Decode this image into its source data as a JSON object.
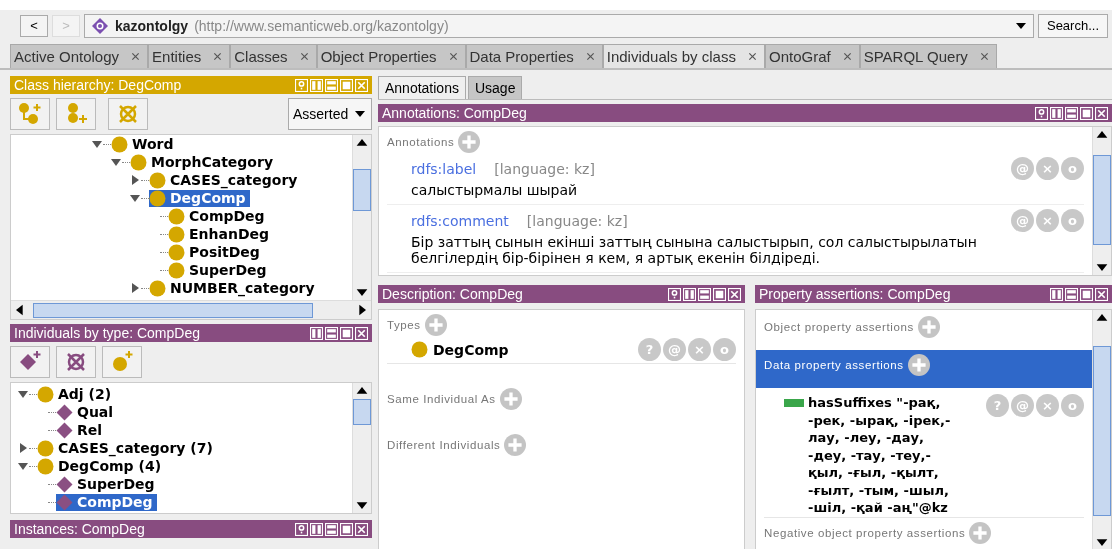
{
  "nav": [
    {
      "label": "<",
      "disabled": false
    },
    {
      "label": ">",
      "disabled": true
    }
  ],
  "address": {
    "name": "kazontolgy",
    "iri": "(http://www.semanticweb.org/kazontolgy)"
  },
  "search_button": "Search...",
  "tabs": [
    {
      "label": "Active Ontology",
      "selected": false
    },
    {
      "label": "Entities",
      "selected": false
    },
    {
      "label": "Classes",
      "selected": false
    },
    {
      "label": "Object Properties",
      "selected": false
    },
    {
      "label": "Data Properties",
      "selected": false
    },
    {
      "label": "Individuals by class",
      "selected": true
    },
    {
      "label": "OntoGraf",
      "selected": false
    },
    {
      "label": "SPARQL Query",
      "selected": false
    }
  ],
  "class_hierarchy": {
    "title": "Class hierarchy: DegComp",
    "help_button": true,
    "mode": "Asserted",
    "tree": [
      {
        "label": "Word",
        "kind": "class",
        "expanded": true,
        "selected": false,
        "children": [
          {
            "label": "MorphCategory",
            "kind": "class",
            "expanded": true,
            "selected": false,
            "children": [
              {
                "label": "CASES_category",
                "kind": "class",
                "expanded": false,
                "selected": false
              },
              {
                "label": "DegComp",
                "kind": "class",
                "expanded": true,
                "selected": true,
                "children": [
                  {
                    "label": "CompDeg",
                    "kind": "class",
                    "selected": false
                  },
                  {
                    "label": "EnhanDeg",
                    "kind": "class",
                    "selected": false
                  },
                  {
                    "label": "PositDeg",
                    "kind": "class",
                    "selected": false
                  },
                  {
                    "label": "SuperDeg",
                    "kind": "class",
                    "selected": false
                  }
                ]
              },
              {
                "label": "NUMBER_category",
                "kind": "class",
                "expanded": false,
                "selected": false
              }
            ]
          }
        ]
      }
    ]
  },
  "individuals_by_type": {
    "title": "Individuals by type: CompDeg",
    "help_button": false,
    "tree": [
      {
        "label": "Adj (2)",
        "kind": "class",
        "expanded": true,
        "selected": false,
        "children": [
          {
            "label": "Qual",
            "kind": "individual",
            "selected": false
          },
          {
            "label": "Rel",
            "kind": "individual",
            "selected": false
          }
        ]
      },
      {
        "label": "CASES_category (7)",
        "kind": "class",
        "expanded": false,
        "selected": false
      },
      {
        "label": "DegComp (4)",
        "kind": "class",
        "expanded": true,
        "selected": false,
        "children": [
          {
            "label": "SuperDeg",
            "kind": "individual",
            "selected": false
          },
          {
            "label": "CompDeg",
            "kind": "individual",
            "selected": true
          }
        ]
      }
    ]
  },
  "instances": {
    "title": "Instances: CompDeg",
    "help_button": true
  },
  "editor_tabs": [
    {
      "label": "Annotations",
      "selected": true
    },
    {
      "label": "Usage",
      "selected": false
    }
  ],
  "annotations": {
    "title": "Annotations: CompDeg",
    "help_button": true,
    "section": "Annotations",
    "items": [
      {
        "property": "rdfs:label",
        "language": "[language: kz]",
        "value": "салыстырмалы шырай",
        "actions": [
          "@",
          "×",
          "o"
        ]
      },
      {
        "property": "rdfs:comment",
        "language": "[language: kz]",
        "value": "Бір заттың сынын екінші заттың сынына салыстырып, сол салыстырылатын белгілердің бір-бірінен я кем, я артық екенін білдіреді.",
        "actions": [
          "@",
          "×",
          "o"
        ]
      }
    ]
  },
  "description": {
    "title": "Description: CompDeg",
    "help_button": true,
    "sections": [
      {
        "label": "Types",
        "items": [
          {
            "label": "DegComp",
            "actions": [
              "?",
              "@",
              "×",
              "o"
            ]
          }
        ]
      },
      {
        "label": "Same Individual As"
      },
      {
        "label": "Different Individuals"
      }
    ]
  },
  "property_assertions": {
    "title": "Property assertions: CompDeg",
    "help_button": false,
    "sections": [
      {
        "label": "Object property assertions",
        "selected": false
      },
      {
        "label": "Data property assertions",
        "selected": true,
        "items": [
          {
            "property": "hasSuffixes",
            "value": "\"-рақ, -рек, -ырақ, -ірек,-лау, -леу, -дау, -деу, -тау, -теу,-қыл, -ғыл, -қылт, -ғылт, -тым, -шыл, -шіл, -қай -аң\"@kz",
            "actions": [
              "?",
              "@",
              "×",
              "o"
            ]
          }
        ]
      },
      {
        "label": "Negative object property assertions",
        "selected": false
      }
    ]
  }
}
